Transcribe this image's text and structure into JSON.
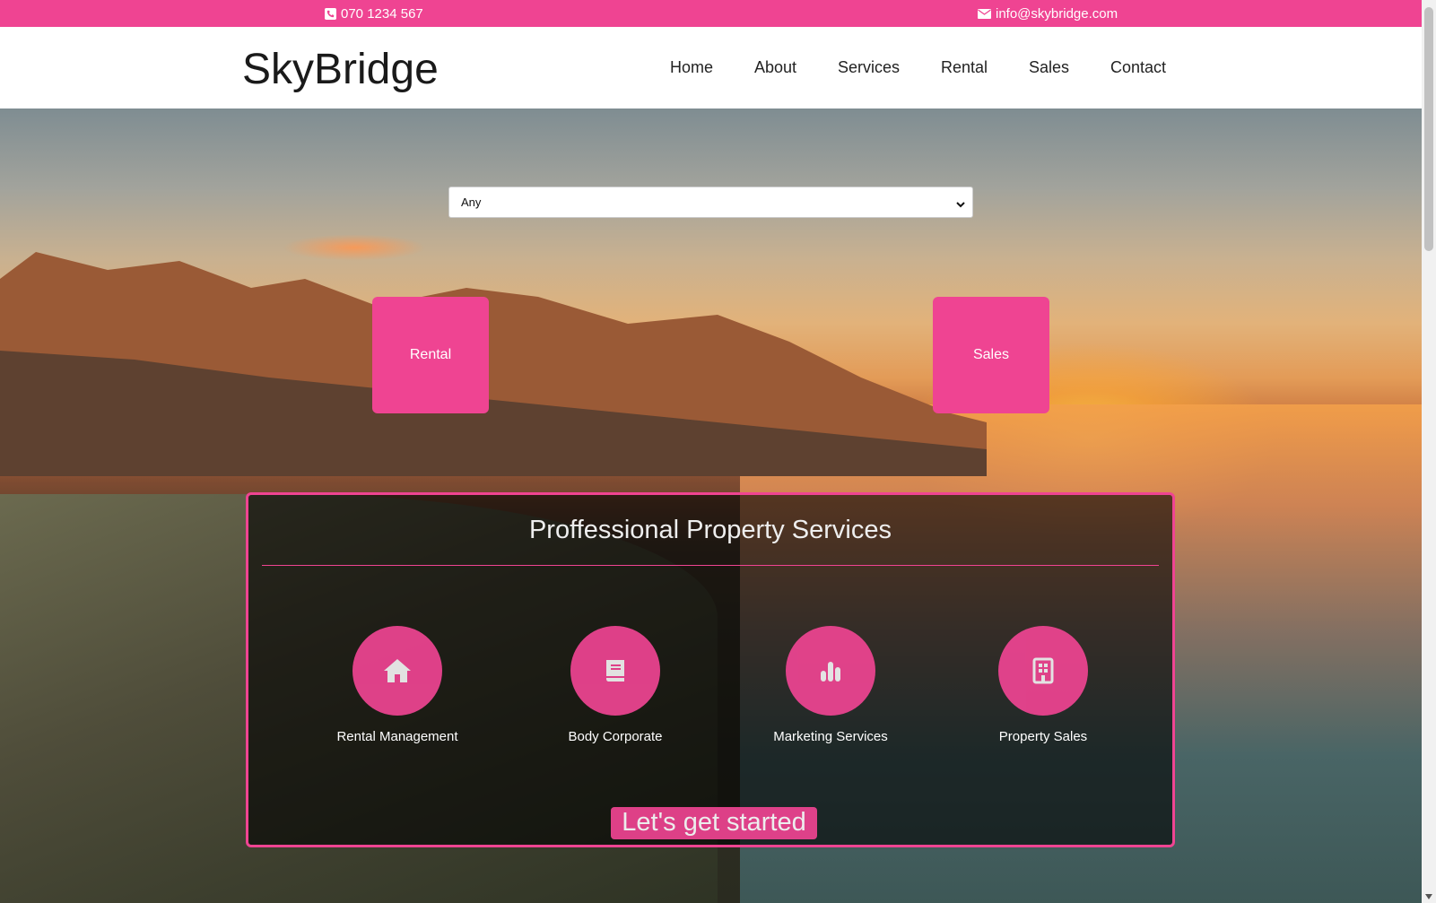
{
  "topbar": {
    "phone": "070 1234 567",
    "email": "info@skybridge.com",
    "phone_icon": "phone-icon",
    "email_icon": "envelope-icon"
  },
  "header": {
    "logo": "SkyBridge",
    "nav": [
      {
        "label": "Home"
      },
      {
        "label": "About"
      },
      {
        "label": "Services"
      },
      {
        "label": "Rental"
      },
      {
        "label": "Sales"
      },
      {
        "label": "Contact"
      }
    ]
  },
  "hero": {
    "select": {
      "selected": "Any"
    },
    "tiles": [
      {
        "label": "Rental"
      },
      {
        "label": "Sales"
      }
    ],
    "panel": {
      "title": "Proffessional Property Services",
      "services": [
        {
          "label": "Rental Management",
          "icon": "home-icon"
        },
        {
          "label": "Body Corporate",
          "icon": "book-icon"
        },
        {
          "label": "Marketing Services",
          "icon": "bar-chart-icon"
        },
        {
          "label": "Property Sales",
          "icon": "building-icon"
        }
      ],
      "cta": "Let's get started"
    }
  },
  "colors": {
    "accent": "#ef4492"
  }
}
